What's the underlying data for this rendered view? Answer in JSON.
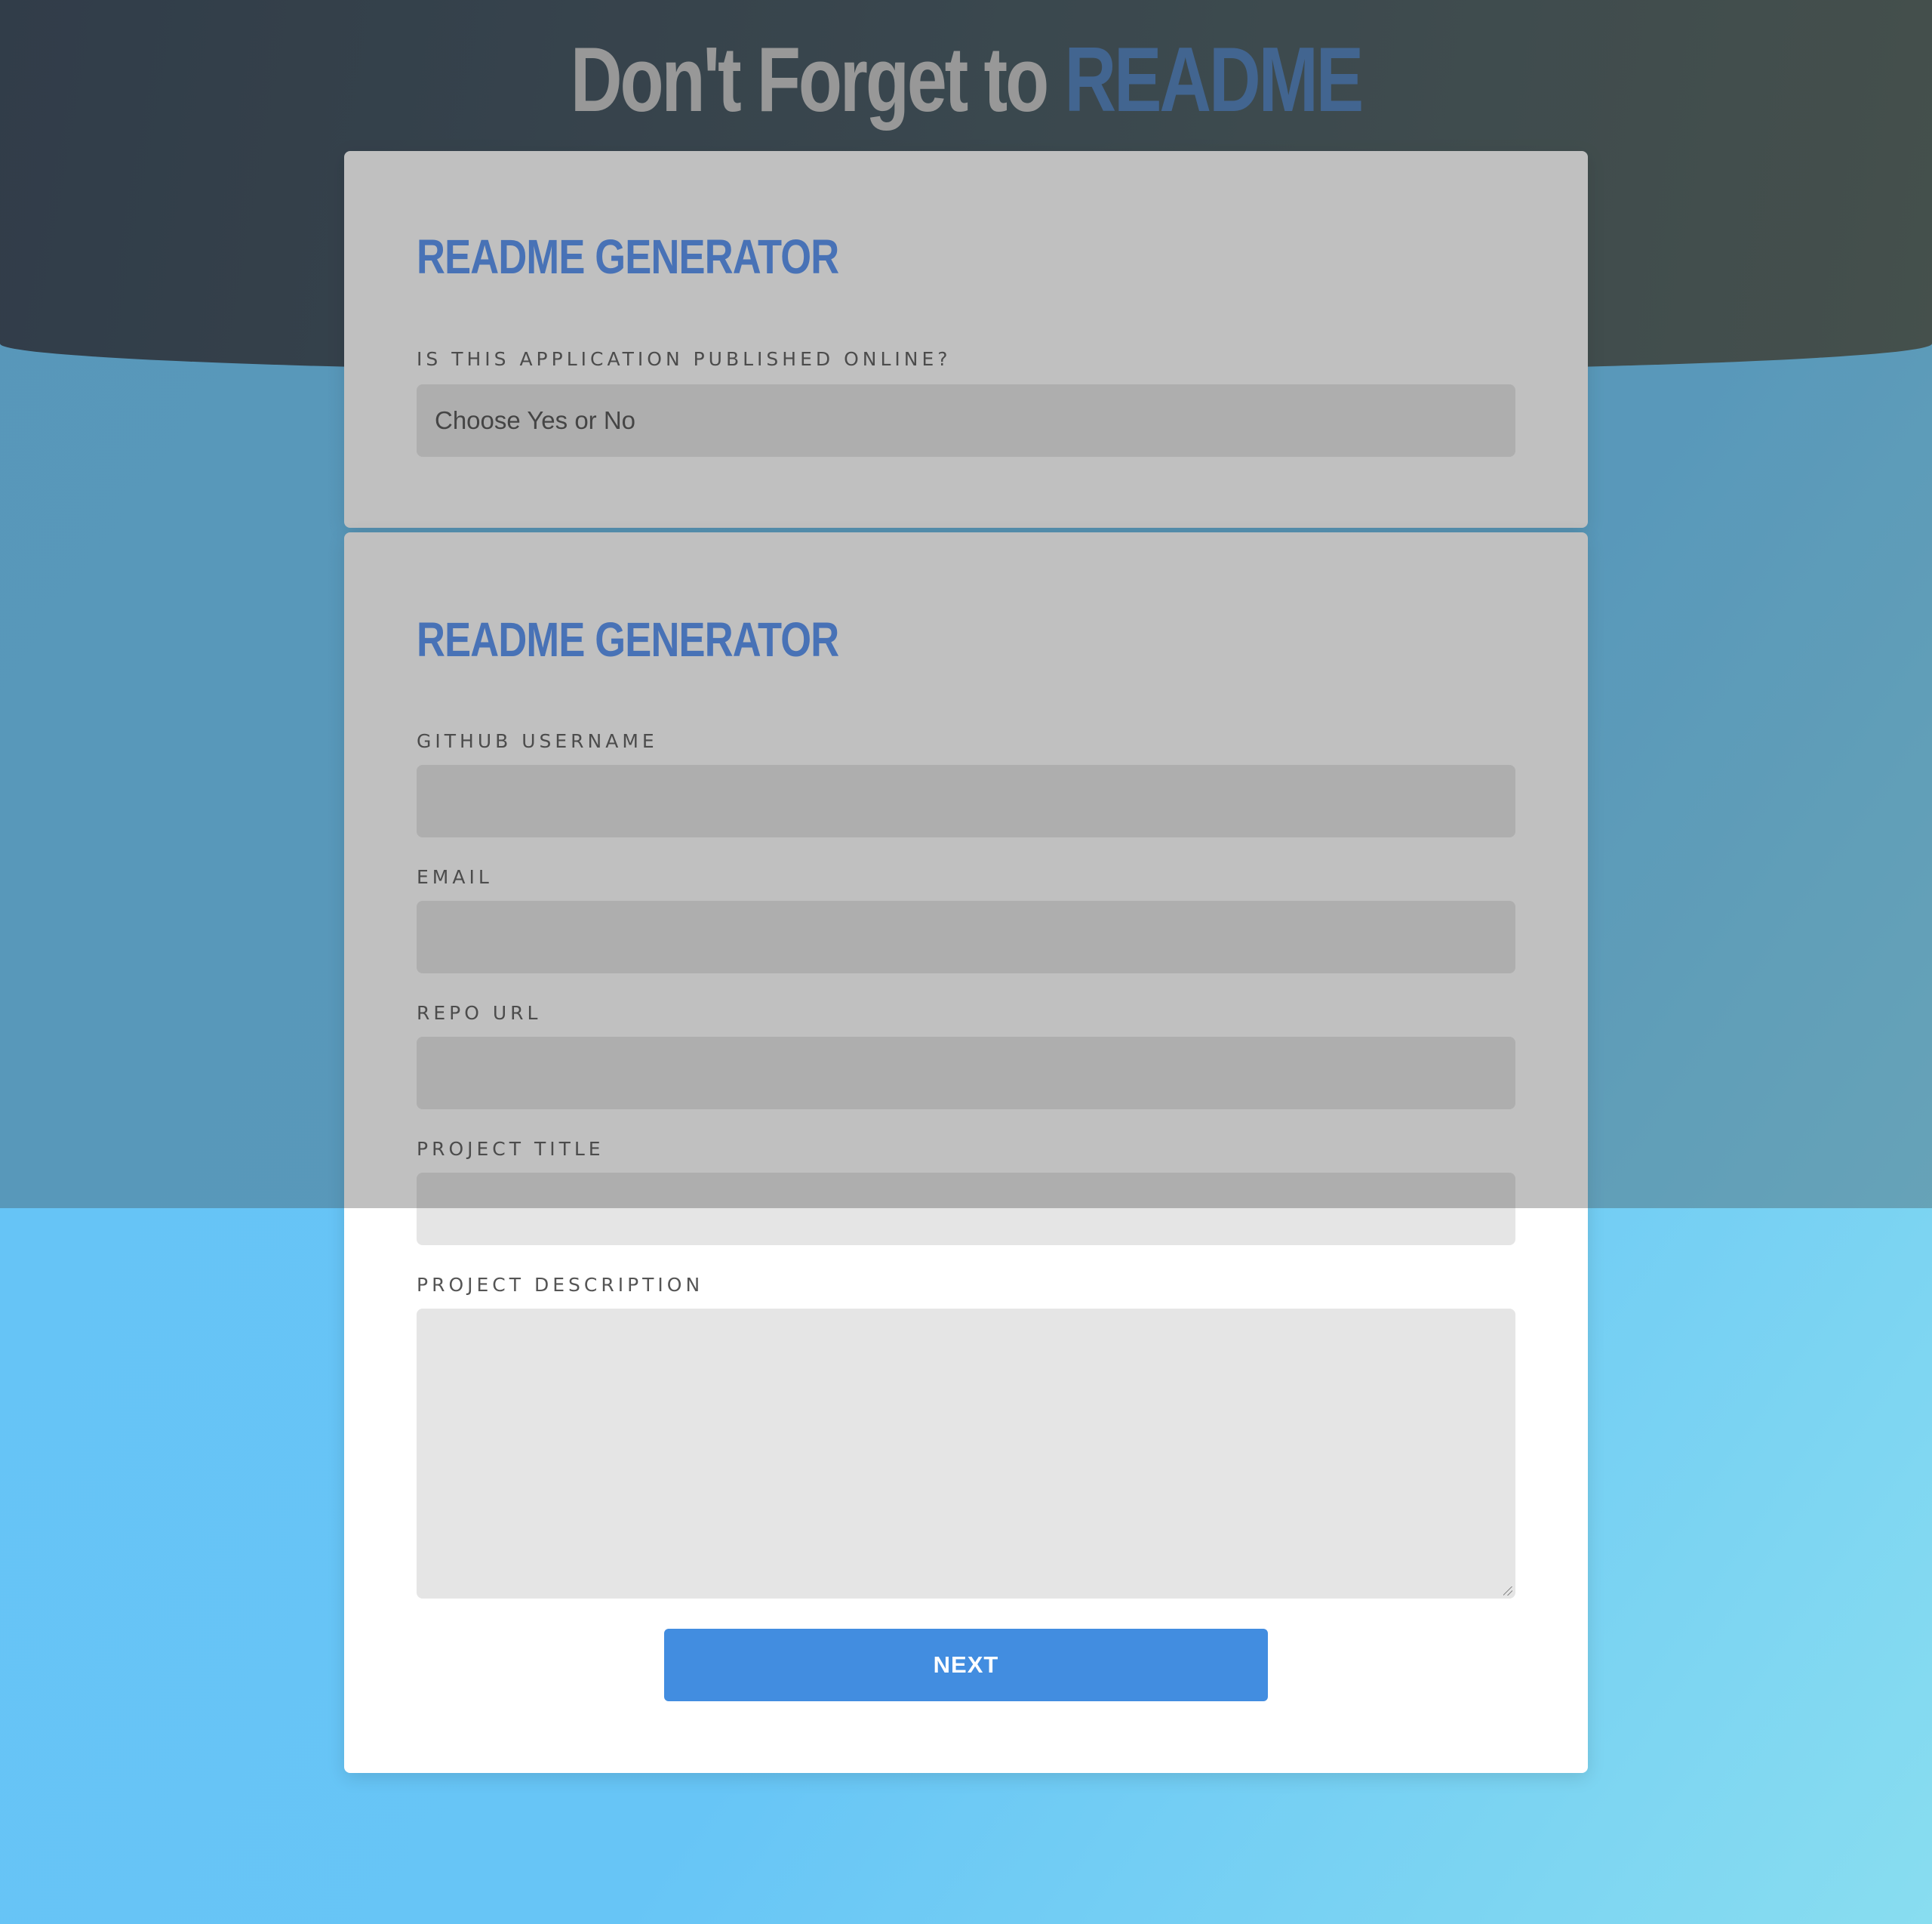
{
  "header": {
    "title_plain": "Don't Forget to",
    "title_accent": "README"
  },
  "card_published": {
    "heading": "README GENERATOR",
    "question_label": "IS THIS APPLICATION PUBLISHED ONLINE?",
    "select_value": "Choose Yes or No"
  },
  "card_details": {
    "heading": "README GENERATOR",
    "fields": [
      {
        "label": "GITHUB USERNAME",
        "value": ""
      },
      {
        "label": "EMAIL",
        "value": ""
      },
      {
        "label": "REPO URL",
        "value": ""
      },
      {
        "label": "PROJECT TITLE",
        "value": ""
      },
      {
        "label": "PROJECT DESCRIPTION",
        "value": ""
      }
    ],
    "next_label": "NEXT"
  },
  "colors": {
    "header_band": "#2d3e50",
    "accent_blue": "#4679b9",
    "heading_blue": "#4f8df0",
    "button_blue": "#428de0",
    "page_background": "#66c3f6"
  }
}
